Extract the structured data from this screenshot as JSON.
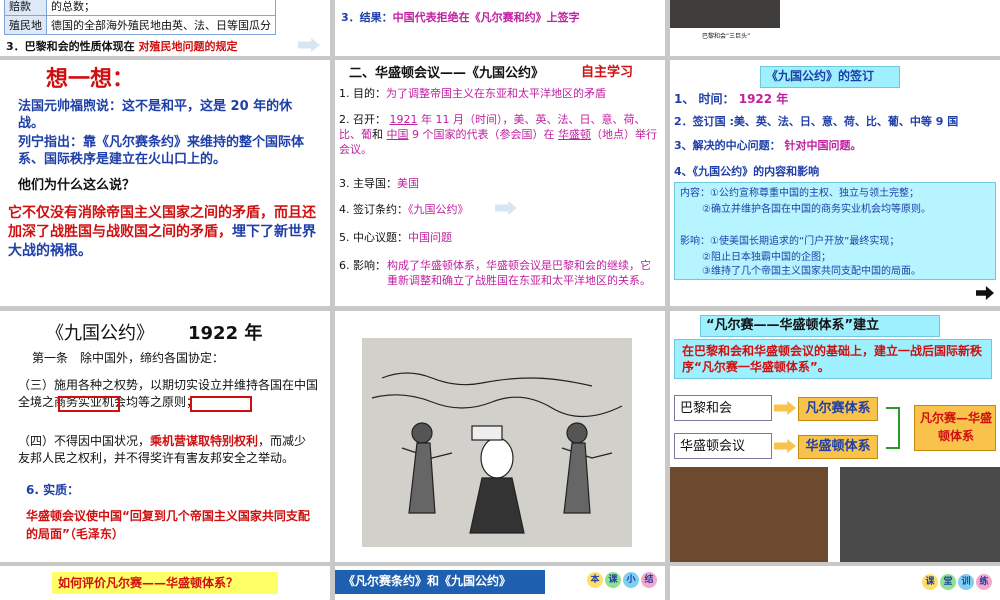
{
  "slide1": {
    "table": [
      [
        "赔款",
        "的总数；"
      ],
      [
        "殖民地",
        "德国的全部海外殖民地由英、法、日等国瓜分"
      ]
    ],
    "item3_prefix": "3．巴黎和会的性质体现在",
    "item3_highlight": "对殖民地问题的规定"
  },
  "slide2": {
    "result_label": "3．结果：",
    "result_text": "中国代表拒绝在《凡尔赛和约》上签字"
  },
  "slide3": {
    "caption": "巴黎和会“三巨头”"
  },
  "slide4": {
    "title": "想一想：",
    "quote1": "法国元帅福煦说：这不是和平，这是 20 年的休战。",
    "quote2": "列宁指出：靠《凡尔赛条约》来维持的整个国际体系、国际秩序是建立在火山口上的。",
    "question": "他们为什么这么说？",
    "answer_red": "它不仅没有消除帝国主义国家之间的矛盾，而且还加深了战胜国与战败国之间的矛盾，",
    "answer_blue": "埋下了新世界大战的祸根。"
  },
  "slide5": {
    "title": "二、华盛顿会议——《九国公约》",
    "self_study": "自主学习",
    "item1_label": "1. 目的：",
    "item1_text": "为了调整帝国主义在东亚和太平洋地区的矛盾",
    "item2_label": "2. 召开：",
    "item2_year": "1921",
    "item2_rest": "年 11 月（时间），美、英、法、日、意、荷、比、葡",
    "item2_rest2": "和",
    "item2_blank": "中国",
    "item2_count": "9 个国家的代表（参会国）在",
    "item2_place": "华盛顿",
    "item2_place_note": "（地点）举行会议。",
    "item3_label": "3. 主导国：",
    "item3_value": "美国",
    "item4_label": "4. 签订条约：",
    "item4_value": "《九国公约》",
    "item5_label": "5. 中心议题：",
    "item5_value": "中国问题",
    "item6_label": "6. 影响：",
    "item6_text": "构成了华盛顿体系，华盛顿会议是巴黎和会的继续，它重新调整和确立了战胜国在东亚和太平洋地区的关系。"
  },
  "slide6": {
    "title": "《九国公约》的签订",
    "time_label": "1、 时间：",
    "time_value": "1922 年",
    "countries": "2．签订国 :美、英、法、日、意、荷、比、葡、中等 9 国",
    "issue_label": "3、解决的中心问题：",
    "issue_value": "针对中国问题。",
    "content_title": "4、《九国公约》的内容和影响",
    "content1": "内容：①公约宣称尊重中国的主权、独立与领土完整；",
    "content2": "②确立并维护各国在中国的商务实业机会均等原则。",
    "impact1": "影响：①使美国长期追求的“门户开放”最终实现；",
    "impact2": "②阻止日本独霸中国的企图；",
    "impact3": "③维持了几个帝国主义国家共同支配中国的局面。"
  },
  "slide7": {
    "title": "《九国公约》",
    "year": "1922 年",
    "article1": "第一条　除中国外，缔约各国协定：",
    "clause3": "（三）施用各种之权势，以期切实设立并维持各国在中国全境之商务实业机会均等之原则；",
    "clause4_prefix": "（四）不得因中国状况，",
    "clause4_highlight": "乘机营谋取特别权利",
    "clause4_rest": "，而减少友邦人民之权利，并不得奖许有害友邦安全之举动。",
    "essence_label": "6. 实质：",
    "essence_text": "华盛顿会议使中国“回复到几个帝国主义国家共同支配的局面”（毛泽东）"
  },
  "slide9": {
    "title": "“凡尔赛——华盛顿体系”建立",
    "banner": "在巴黎和会和华盛顿会议的基础上，建立一战后国际新秩序“凡尔赛一华盛顿体系”。",
    "left1": "巴黎和会",
    "left2": "华盛顿会议",
    "box1": "凡尔赛体系",
    "box2": "华盛顿体系",
    "result": "凡尔赛—华盛顿体系"
  },
  "slide10": {
    "question": "如何评价凡尔赛——华盛顿体系？"
  },
  "slide11": {
    "title": "《凡尔赛条约》和《九国公约》",
    "badges": [
      "本",
      "课",
      "小",
      "结"
    ]
  },
  "slide12": {
    "badges": [
      "课",
      "堂",
      "训",
      "练"
    ]
  },
  "colors": {
    "title_blue": "#1f3fa8",
    "accent_red": "#d01010",
    "accent_magenta": "#c020a0",
    "cyan_box": "#9ff0ff",
    "orange_box": "#f9c24a"
  }
}
